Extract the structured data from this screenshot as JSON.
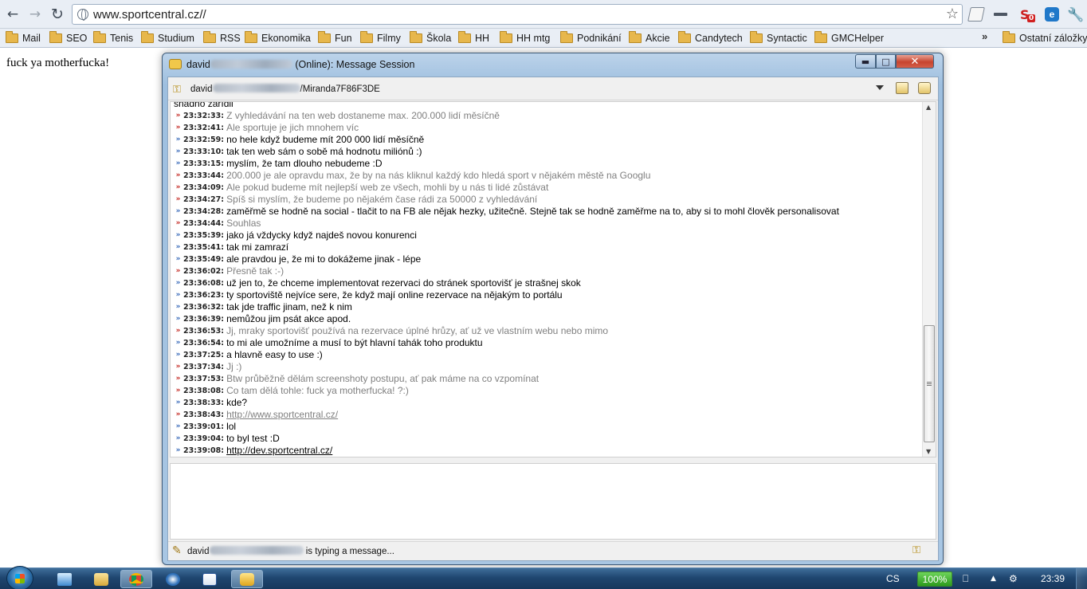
{
  "browser": {
    "url": "www.sportcentral.cz//",
    "bookmarks": [
      "Mail",
      "SEO",
      "Tenis",
      "Studium",
      "RSS",
      "Ekonomika",
      "Fun",
      "Filmy",
      "Škola",
      "HH",
      "HH mtg",
      "Podnikání",
      "Akcie",
      "Candytech",
      "Syntactic",
      "GMCHelper"
    ],
    "bookmarks_more": "»",
    "other_bookmarks": "Ostatní záložky",
    "ext_badge": "0"
  },
  "page": {
    "text": "fuck ya motherfucka!"
  },
  "msgwin": {
    "title_prefix": "david",
    "title_suffix": "(Online): Message Session",
    "contact_prefix": "david",
    "contact_suffix": "/Miranda7F86F3DE",
    "status_prefix": "david",
    "status_suffix": "is typing a message...",
    "messages": [
      {
        "dir": "cont",
        "time": "",
        "text": "snadno zařídil"
      },
      {
        "dir": "in",
        "time": "23:32:33:",
        "text": "Z vyhledávání na ten web dostaneme max. 200.000 lidí měsíčně"
      },
      {
        "dir": "in",
        "time": "23:32:41:",
        "text": "Ale sportuje je jich mnohem víc"
      },
      {
        "dir": "out",
        "time": "23:32:59:",
        "text": "no hele když budeme mít 200 000 lidí měsíčně"
      },
      {
        "dir": "out",
        "time": "23:33:10:",
        "text": "tak ten web sám o sobě má hodnotu miliónů :)"
      },
      {
        "dir": "out",
        "time": "23:33:15:",
        "text": "myslím, že tam dlouho nebudeme :D"
      },
      {
        "dir": "in",
        "time": "23:33:44:",
        "text": "200.000 je ale opravdu max, že by na nás kliknul každý kdo hledá sport v nějakém městě na Googlu"
      },
      {
        "dir": "in",
        "time": "23:34:09:",
        "text": "Ale pokud budeme mít nejlepší web ze všech, mohli by u nás ti lidé zůstávat"
      },
      {
        "dir": "in",
        "time": "23:34:27:",
        "text": "Spíš si myslím, že budeme po nějakém čase rádi za 50000 z vyhledávání"
      },
      {
        "dir": "out",
        "time": "23:34:28:",
        "text": "zaměřmě se hodně na social - tlačit to na FB ale nějak hezky, užitečně. Stejně tak se hodně zaměřme na to, aby si to mohl člověk personalisovat"
      },
      {
        "dir": "in",
        "time": "23:34:44:",
        "text": "Souhlas"
      },
      {
        "dir": "out",
        "time": "23:35:39:",
        "text": "jako já vždycky když najdeš novou konurenci"
      },
      {
        "dir": "out",
        "time": "23:35:41:",
        "text": "tak mi zamrazí"
      },
      {
        "dir": "out",
        "time": "23:35:49:",
        "text": "ale pravdou je, že mi to dokážeme jinak - lépe"
      },
      {
        "dir": "in",
        "time": "23:36:02:",
        "text": "Přesně tak :-)"
      },
      {
        "dir": "out",
        "time": "23:36:08:",
        "text": "už jen to, že chceme implementovat rezervaci do stránek sportovišť je strašnej skok"
      },
      {
        "dir": "out",
        "time": "23:36:23:",
        "text": "ty sportoviště nejvíce sere, že když mají online rezervace na nějakým to portálu"
      },
      {
        "dir": "out",
        "time": "23:36:32:",
        "text": "tak jde traffic jinam, než k nim"
      },
      {
        "dir": "out",
        "time": "23:36:39:",
        "text": "nemůžou jim psát akce apod."
      },
      {
        "dir": "in",
        "time": "23:36:53:",
        "text": "Jj, mraky sportovišť používá na rezervace úplné hrůzy, ať už ve vlastním webu nebo mimo"
      },
      {
        "dir": "out",
        "time": "23:36:54:",
        "text": "to mi ale umožníme a musí to být hlavní tahák toho produktu"
      },
      {
        "dir": "out",
        "time": "23:37:25:",
        "text": "a hlavně easy to use :)"
      },
      {
        "dir": "in",
        "time": "23:37:34:",
        "text": "Jj :)"
      },
      {
        "dir": "in",
        "time": "23:37:53:",
        "text": "Btw průběžně dělám screenshoty postupu, ať pak máme na co vzpomínat"
      },
      {
        "dir": "in",
        "time": "23:38:08:",
        "text": "Co tam dělá tohle: fuck ya motherfucka! ?:)"
      },
      {
        "dir": "out",
        "time": "23:38:33:",
        "text": "kde?"
      },
      {
        "dir": "in",
        "time": "23:38:43:",
        "text": "http://www.sportcentral.cz/",
        "link": true
      },
      {
        "dir": "out",
        "time": "23:39:01:",
        "text": "lol"
      },
      {
        "dir": "out",
        "time": "23:39:04:",
        "text": "to byl test :D"
      },
      {
        "dir": "out",
        "time": "23:39:08:",
        "text": "http://dev.sportcentral.cz/",
        "link": true
      }
    ]
  },
  "taskbar": {
    "lang": "CS",
    "battery": "100%",
    "clock": "23:39"
  },
  "colors": {
    "incoming_marker": "#c2201a",
    "outgoing_marker": "#2f63b6",
    "incoming_text": "#808080",
    "link": "#0b4fbf"
  }
}
